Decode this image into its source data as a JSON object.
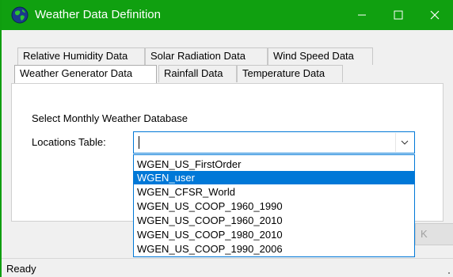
{
  "window": {
    "title": "Weather Data Definition",
    "title_bar_color": "#10a010",
    "accent_color": "#0078d7",
    "app_icon": "globe-icon",
    "controls": [
      "minimize-icon",
      "maximize-icon",
      "close-icon"
    ]
  },
  "tabs": {
    "row1": [
      "Relative Humidity Data",
      "Solar Radiation Data",
      "Wind Speed Data"
    ],
    "row2": [
      "Weather Generator Data",
      "Rainfall Data",
      "Temperature Data"
    ],
    "active": "Weather Generator Data"
  },
  "panel": {
    "section_label": "Select Monthly Weather Database",
    "locations_label": "Locations Table:",
    "locations_value": "",
    "dropdown_icon": "chevron-down-icon"
  },
  "dropdown": {
    "items": [
      "WGEN_US_FirstOrder",
      "WGEN_user",
      "WGEN_CFSR_World",
      "WGEN_US_COOP_1960_1990",
      "WGEN_US_COOP_1960_2010",
      "WGEN_US_COOP_1980_2010",
      "WGEN_US_COOP_1990_2006"
    ],
    "selected_index": 1
  },
  "bottom_button": {
    "label_fragment": "K"
  },
  "status": {
    "text": "Ready"
  }
}
